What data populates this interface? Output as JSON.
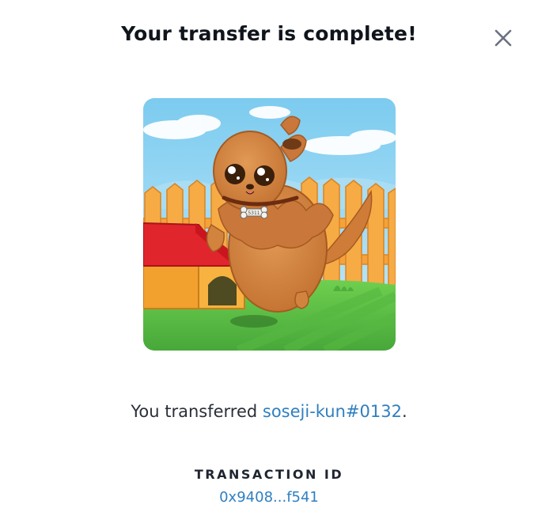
{
  "dialog": {
    "title": "Your transfer is complete!",
    "close_icon": "close-icon"
  },
  "nft": {
    "image_alt": "soseji-kun#0132",
    "collar_tag": "5311",
    "scene_colors": {
      "sky": "#8fd3f2",
      "fence": "#f5a23c",
      "grass": "#5cc046",
      "dog": "#d27f3a",
      "doghouse_roof": "#e0252d",
      "doghouse_wall": "#f2a02e"
    }
  },
  "message": {
    "prefix": "You transferred ",
    "item_name": "soseji-kun#0132",
    "suffix": "."
  },
  "transaction": {
    "label": "TRANSACTION ID",
    "id_short": "0x9408...f541"
  },
  "colors": {
    "link": "#2f7fc0",
    "text": "#1f2530"
  }
}
